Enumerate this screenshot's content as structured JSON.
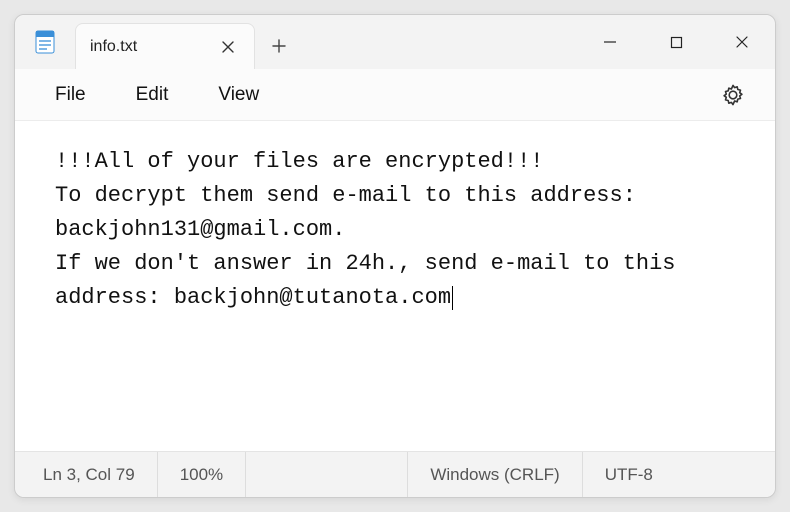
{
  "tab": {
    "title": "info.txt"
  },
  "menu": {
    "file": "File",
    "edit": "Edit",
    "view": "View"
  },
  "content": {
    "text": "!!!All of your files are encrypted!!!\nTo decrypt them send e-mail to this address: backjohn131@gmail.com.\nIf we don't answer in 24h., send e-mail to this address: backjohn@tutanota.com"
  },
  "status": {
    "position": "Ln 3, Col 79",
    "zoom": "100%",
    "lineending": "Windows (CRLF)",
    "encoding": "UTF-8"
  }
}
